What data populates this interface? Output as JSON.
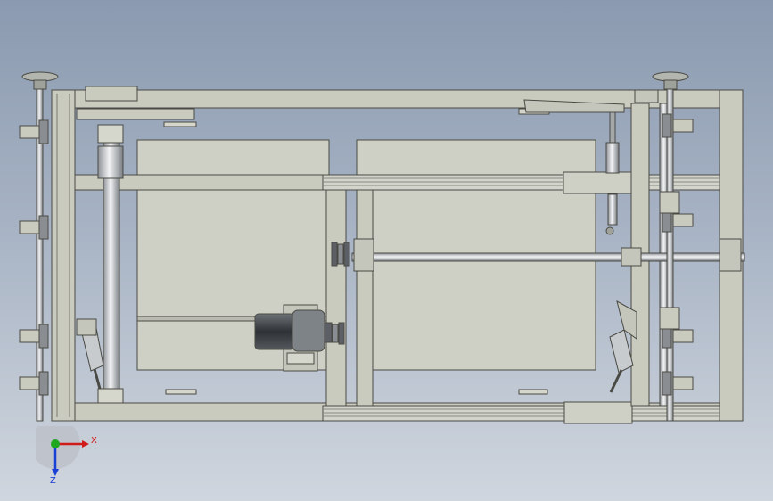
{
  "viewport": {
    "background_top": "#8b9ab0",
    "background_bottom": "#d0d6de",
    "part_fill": "#c9cbbf",
    "part_stroke": "#4a4a44",
    "panel_fill": "#cfd0c5",
    "steel": "#bfc3c6",
    "motor_dark": "#3b3f44"
  },
  "triad": {
    "x_label": "X",
    "y_label": "Y",
    "z_label": "Z",
    "x_color": "#d11b1b",
    "y_color": "#1fa81f",
    "z_color": "#1a3fd6"
  }
}
